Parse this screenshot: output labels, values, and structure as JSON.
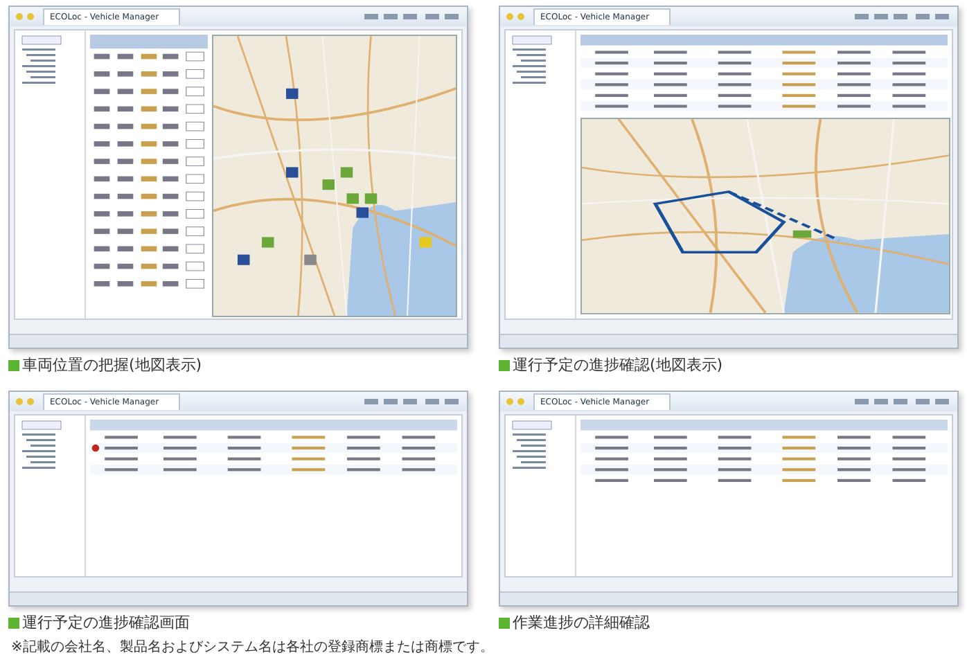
{
  "panels": [
    {
      "kind": "map-list",
      "window_title": "ECOLoc - Vehicle Manager",
      "caption": "車両位置の把握(地図表示)"
    },
    {
      "kind": "map-route",
      "window_title": "ECOLoc - Vehicle Manager",
      "caption": "運行予定の進捗確認(地図表示)"
    },
    {
      "kind": "list",
      "window_title": "ECOLoc - Vehicle Manager",
      "caption": "運行予定の進捗確認画面"
    },
    {
      "kind": "table",
      "window_title": "ECOLoc - Vehicle Manager",
      "caption": "作業進捗の詳細確認"
    }
  ],
  "footnote": "※記載の会社名、製品名およびシステム名は各社の登録商標または商標です。"
}
